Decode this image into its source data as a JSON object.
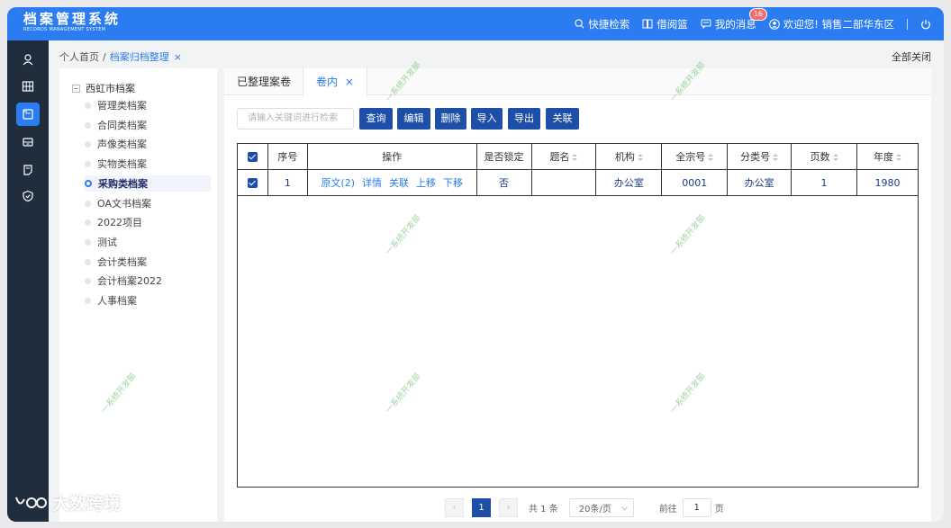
{
  "app": {
    "title_cn": "档案管理系统",
    "title_en": "RECORDS MANAGEMENT SYSTEM"
  },
  "topnav": {
    "quick_search": "快捷检索",
    "borrow_basket": "借阅篮",
    "messages": "我的消息",
    "message_count": "16",
    "welcome": "欢迎您! 销售二部华东区"
  },
  "breadcrumb": {
    "home": "个人首页",
    "current": "档案归档整理",
    "close_symbol": "×",
    "close_all": "全部关闭"
  },
  "tree": {
    "root": "西虹市档案",
    "items": [
      {
        "label": "管理类档案"
      },
      {
        "label": "合同类档案"
      },
      {
        "label": "声像类档案"
      },
      {
        "label": "实物类档案"
      },
      {
        "label": "采购类档案"
      },
      {
        "label": "OA文书档案"
      },
      {
        "label": "2022项目"
      },
      {
        "label": "测试"
      },
      {
        "label": "会计类档案"
      },
      {
        "label": "会计档案2022"
      },
      {
        "label": "人事档案"
      }
    ]
  },
  "tabs": {
    "organized": "已整理案卷",
    "inner": "卷内",
    "close_symbol": "×"
  },
  "toolbar": {
    "search_placeholder": "请输入关键词进行检索",
    "query": "查询",
    "edit": "编辑",
    "delete": "删除",
    "import": "导入",
    "export": "导出",
    "link": "关联"
  },
  "table": {
    "headers": [
      "序号",
      "操作",
      "是否锁定",
      "题名",
      "机构",
      "全宗号",
      "分类号",
      "页数",
      "年度"
    ],
    "row": {
      "index": "1",
      "op_original": "原文(2)",
      "op_detail": "详情",
      "op_link": "关联",
      "op_up": "上移",
      "op_down": "下移",
      "locked": "否",
      "title": "",
      "org": "办公室",
      "fonds": "0001",
      "category": "办公室",
      "pages": "1",
      "year": "1980"
    }
  },
  "pager": {
    "prev": "‹",
    "next": "›",
    "current": "1",
    "total": "共 1 条",
    "page_size": "20条/页",
    "goto_label": "前往",
    "goto_value": "1",
    "goto_suffix": "页"
  },
  "watermark": "一系统开发部",
  "corner_brand": "大数跨境",
  "colors": {
    "topbar": "#2b7cf0",
    "sidebar": "#1f2d3d",
    "button": "#1d4fa8",
    "link": "#2b7cf0"
  }
}
